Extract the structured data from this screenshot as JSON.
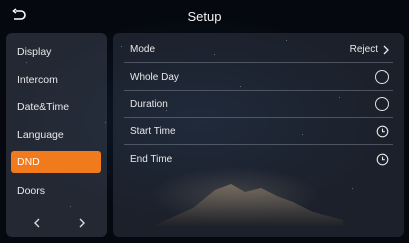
{
  "header": {
    "title": "Setup",
    "back_icon": "back-arrow-icon"
  },
  "sidebar": {
    "items": [
      {
        "label": "Display"
      },
      {
        "label": "Intercom"
      },
      {
        "label": "Date&Time"
      },
      {
        "label": "Language"
      },
      {
        "label": "DND",
        "active": true
      },
      {
        "label": "Doors"
      }
    ],
    "prev_icon": "chevron-left-icon",
    "next_icon": "chevron-right-icon"
  },
  "settings": {
    "rows": [
      {
        "label": "Mode",
        "value": "Reject",
        "control": "chevron-right-icon"
      },
      {
        "label": "Whole Day",
        "control": "radio-off-icon"
      },
      {
        "label": "Duration",
        "control": "radio-off-icon"
      },
      {
        "label": "Start Time",
        "control": "clock-icon"
      },
      {
        "label": "End Time",
        "control": "clock-icon"
      }
    ]
  },
  "colors": {
    "accent": "#f07a1c",
    "background": "#05080e"
  }
}
